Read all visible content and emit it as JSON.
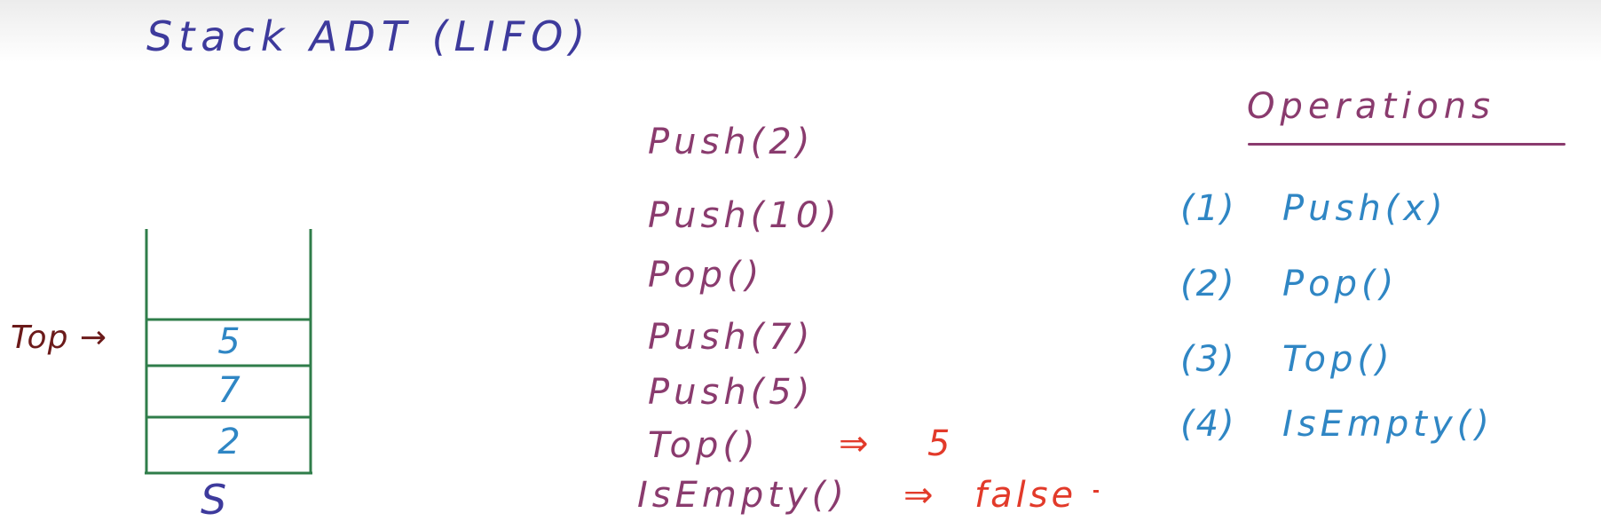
{
  "colors": {
    "title": "#3d3a9c",
    "sequence": "#8a3b6e",
    "result": "#e23a2a",
    "operations": "#2f86c4",
    "stack_lines": "#2f7d4a",
    "cell_values": "#2f86c4",
    "top_label": "#6b1a1a",
    "stack_name": "#3d3a9c"
  },
  "title": "Stack ADT (LIFO)",
  "sequence": [
    {
      "op": "Push(2)"
    },
    {
      "op": "Push(10)"
    },
    {
      "op": "Pop()"
    },
    {
      "op": "Push(7)"
    },
    {
      "op": "Push(5)"
    },
    {
      "op": "Top()",
      "arrow": "⇒",
      "result": "5"
    },
    {
      "op": "IsEmpty()",
      "arrow": "⇒",
      "result": "false"
    }
  ],
  "operations": {
    "heading": "Operations",
    "items": [
      {
        "num": "(1)",
        "name": "Push(x)"
      },
      {
        "num": "(2)",
        "name": "Pop()"
      },
      {
        "num": "(3)",
        "name": "Top()"
      },
      {
        "num": "(4)",
        "name": "IsEmpty()"
      }
    ]
  },
  "stack": {
    "name": "S",
    "top_label": "Top →",
    "cells": [
      "5",
      "7",
      "2"
    ]
  }
}
